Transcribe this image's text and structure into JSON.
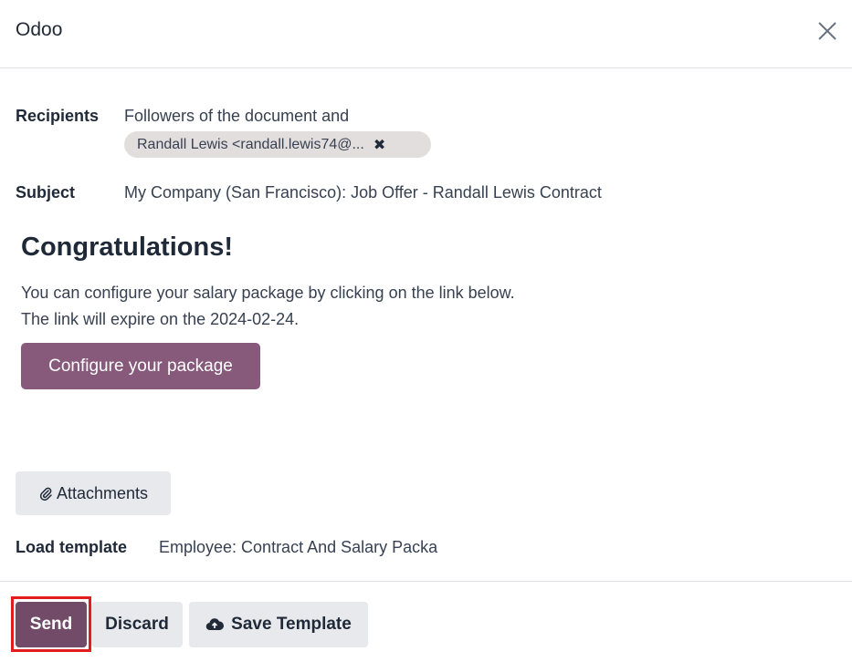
{
  "dialog": {
    "title": "Odoo"
  },
  "recipients": {
    "label": "Recipients",
    "followers_text": "Followers of the document and",
    "tags": [
      {
        "label": "Randall Lewis <randall.lewis74@...",
        "remove_glyph": "✖"
      }
    ]
  },
  "subject": {
    "label": "Subject",
    "value": "My Company (San Francisco): Job Offer - Randall Lewis Contract"
  },
  "body": {
    "heading": "Congratulations!",
    "line1": "You can configure your salary package by clicking on the link below.",
    "line2": "The link will expire on the 2024-02-24.",
    "button_label": "Configure your package"
  },
  "attachments": {
    "label": "Attachments",
    "icon": "paperclip-icon"
  },
  "load_template": {
    "label": "Load template",
    "value": "Employee: Contract And Salary Package"
  },
  "footer": {
    "send_label": "Send",
    "discard_label": "Discard",
    "save_template_label": "Save Template",
    "save_template_icon": "cloud-upload-icon"
  },
  "colors": {
    "brand_primary": "#714b67",
    "body_button": "#875a7b",
    "highlight_outline": "#e11d1d",
    "secondary_button": "#e7e9ed",
    "tag_background": "#e3dede"
  }
}
